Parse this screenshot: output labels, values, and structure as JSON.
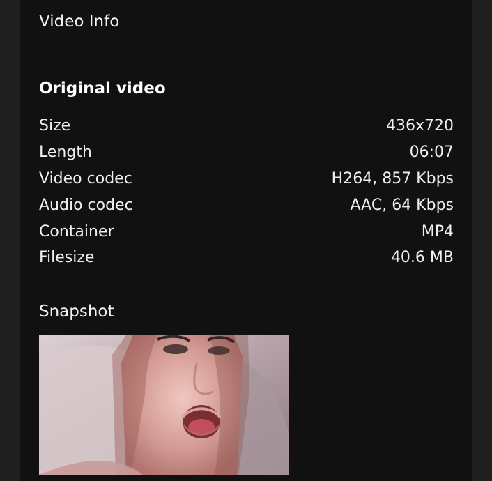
{
  "header": {
    "title": "Video Info"
  },
  "original_video": {
    "title": "Original video",
    "rows": [
      {
        "label": "Size",
        "value": "436x720"
      },
      {
        "label": "Length",
        "value": "06:07"
      },
      {
        "label": "Video codec",
        "value": "H264, 857 Kbps"
      },
      {
        "label": "Audio codec",
        "value": "AAC, 64 Kbps"
      },
      {
        "label": "Container",
        "value": "MP4"
      },
      {
        "label": "Filesize",
        "value": "40.6 MB"
      }
    ]
  },
  "snapshot": {
    "title": "Snapshot"
  },
  "colors": {
    "background": "#1f1f1f",
    "panel": "#111111",
    "text": "#f2f2f2"
  }
}
